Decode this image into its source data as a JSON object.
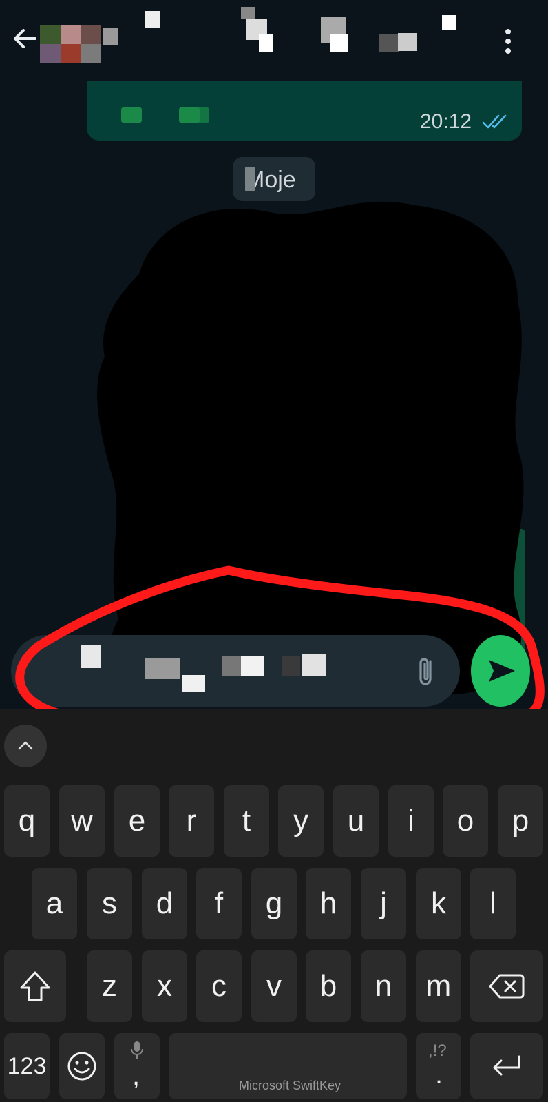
{
  "header": {
    "back_icon": "arrow-left-icon",
    "menu_icon": "more-vertical-icon"
  },
  "chat": {
    "message_time": "20:12",
    "read_receipt_icon": "double-check-icon",
    "date_label": "Moje"
  },
  "composer": {
    "attach_icon": "paperclip-icon",
    "send_icon": "send-icon"
  },
  "keyboard": {
    "collapse_icon": "chevron-up-icon",
    "row1": [
      "q",
      "w",
      "e",
      "r",
      "t",
      "y",
      "u",
      "i",
      "o",
      "p"
    ],
    "row2": [
      "a",
      "s",
      "d",
      "f",
      "g",
      "h",
      "j",
      "k",
      "l"
    ],
    "row3": [
      "z",
      "x",
      "c",
      "v",
      "b",
      "n",
      "m"
    ],
    "numbers_key": "123",
    "comma_key": ",",
    "period_key": ".",
    "punct_hint": ",!?",
    "brand": "Microsoft SwiftKey",
    "shift_icon": "shift-icon",
    "backspace_icon": "backspace-icon",
    "emoji_icon": "emoji-icon",
    "mic_icon": "microphone-icon",
    "enter_icon": "enter-icon"
  },
  "colors": {
    "background": "#0b141a",
    "outgoing_bubble": "#005c4b",
    "send_button": "#21c063",
    "annotation": "#ff1a1a",
    "read_tick": "#53bdeb"
  }
}
